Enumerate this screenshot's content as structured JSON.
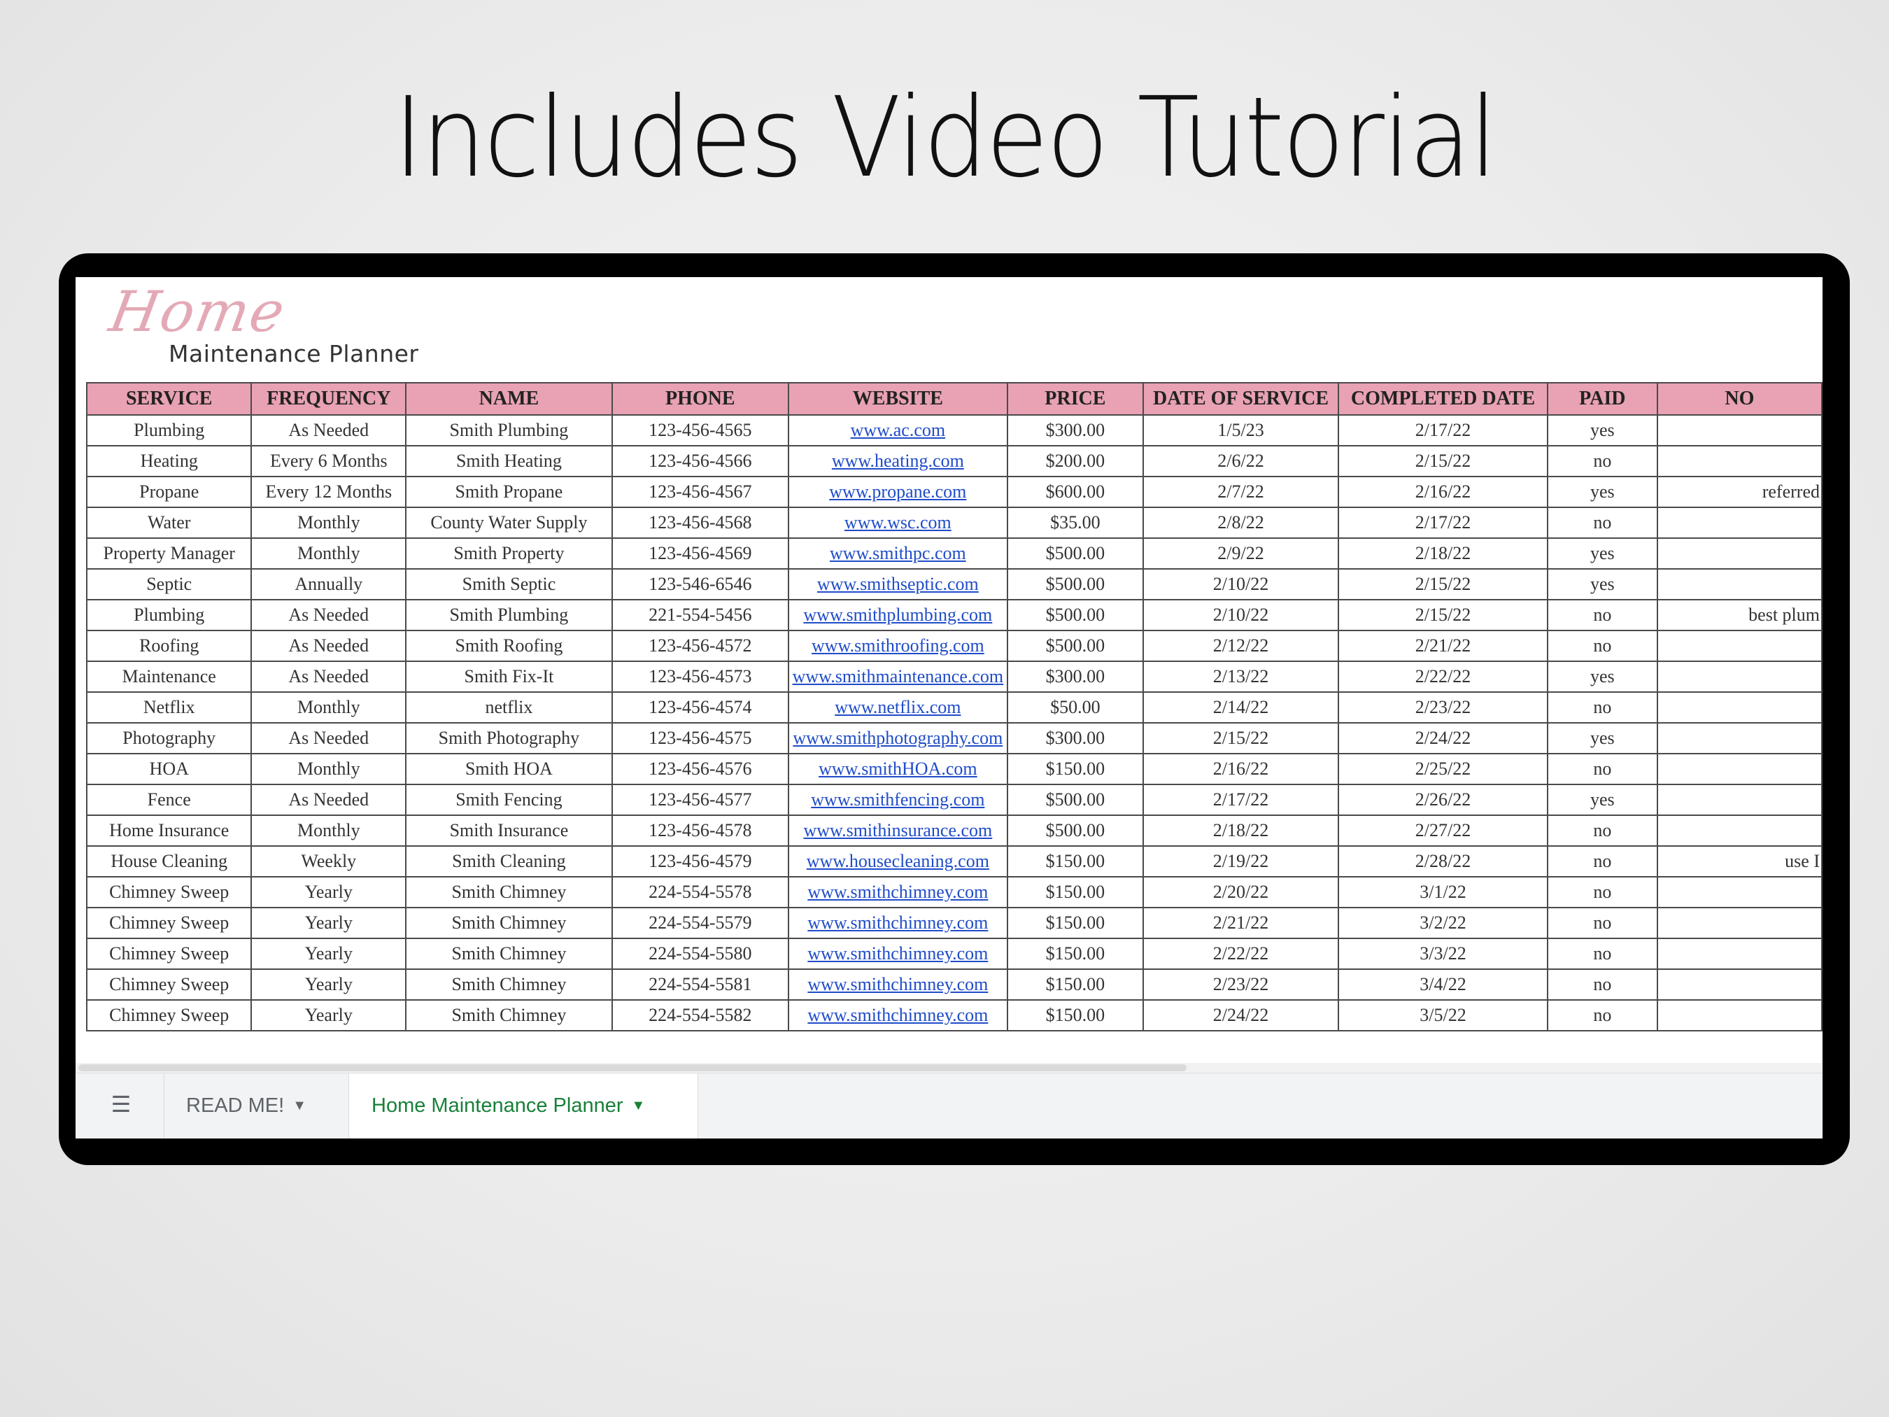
{
  "headline": "Includes Video Tutorial",
  "logo": {
    "script": "Home",
    "subtitle": "Maintenance Planner"
  },
  "table": {
    "columns": [
      "SERVICE",
      "FREQUENCY",
      "NAME",
      "PHONE",
      "WEBSITE",
      "PRICE",
      "DATE OF SERVICE",
      "COMPLETED DATE",
      "PAID",
      "NO"
    ],
    "rows": [
      [
        "Plumbing",
        "As Needed",
        "Smith Plumbing",
        "123-456-4565",
        "www.ac.com",
        "$300.00",
        "1/5/23",
        "2/17/22",
        "yes",
        ""
      ],
      [
        "Heating",
        "Every 6 Months",
        "Smith Heating",
        "123-456-4566",
        "www.heating.com",
        "$200.00",
        "2/6/22",
        "2/15/22",
        "no",
        ""
      ],
      [
        "Propane",
        "Every 12 Months",
        "Smith Propane",
        "123-456-4567",
        "www.propane.com",
        "$600.00",
        "2/7/22",
        "2/16/22",
        "yes",
        "referred"
      ],
      [
        "Water",
        "Monthly",
        "County Water Supply",
        "123-456-4568",
        "www.wsc.com",
        "$35.00",
        "2/8/22",
        "2/17/22",
        "no",
        ""
      ],
      [
        "Property Manager",
        "Monthly",
        "Smith Property",
        "123-456-4569",
        "www.smithpc.com",
        "$500.00",
        "2/9/22",
        "2/18/22",
        "yes",
        ""
      ],
      [
        "Septic",
        "Annually",
        "Smith Septic",
        "123-546-6546",
        "www.smithseptic.com",
        "$500.00",
        "2/10/22",
        "2/15/22",
        "yes",
        ""
      ],
      [
        "Plumbing",
        "As Needed",
        "Smith Plumbing",
        "221-554-5456",
        "www.smithplumbing.com",
        "$500.00",
        "2/10/22",
        "2/15/22",
        "no",
        "best plum"
      ],
      [
        "Roofing",
        "As Needed",
        "Smith Roofing",
        "123-456-4572",
        "www.smithroofing.com",
        "$500.00",
        "2/12/22",
        "2/21/22",
        "no",
        ""
      ],
      [
        "Maintenance",
        "As Needed",
        "Smith Fix-It",
        "123-456-4573",
        "www.smithmaintenance.com",
        "$300.00",
        "2/13/22",
        "2/22/22",
        "yes",
        ""
      ],
      [
        "Netflix",
        "Monthly",
        "netflix",
        "123-456-4574",
        "www.netflix.com",
        "$50.00",
        "2/14/22",
        "2/23/22",
        "no",
        ""
      ],
      [
        "Photography",
        "As Needed",
        "Smith Photography",
        "123-456-4575",
        "www.smithphotography.com",
        "$300.00",
        "2/15/22",
        "2/24/22",
        "yes",
        ""
      ],
      [
        "HOA",
        "Monthly",
        "Smith HOA",
        "123-456-4576",
        "www.smithHOA.com",
        "$150.00",
        "2/16/22",
        "2/25/22",
        "no",
        ""
      ],
      [
        "Fence",
        "As Needed",
        "Smith Fencing",
        "123-456-4577",
        "www.smithfencing.com",
        "$500.00",
        "2/17/22",
        "2/26/22",
        "yes",
        ""
      ],
      [
        "Home Insurance",
        "Monthly",
        "Smith Insurance",
        "123-456-4578",
        "www.smithinsurance.com",
        "$500.00",
        "2/18/22",
        "2/27/22",
        "no",
        ""
      ],
      [
        "House Cleaning",
        "Weekly",
        "Smith Cleaning",
        "123-456-4579",
        "www.housecleaning.com",
        "$150.00",
        "2/19/22",
        "2/28/22",
        "no",
        "use I"
      ],
      [
        "Chimney Sweep",
        "Yearly",
        "Smith Chimney",
        "224-554-5578",
        "www.smithchimney.com",
        "$150.00",
        "2/20/22",
        "3/1/22",
        "no",
        ""
      ],
      [
        "Chimney Sweep",
        "Yearly",
        "Smith Chimney",
        "224-554-5579",
        "www.smithchimney.com",
        "$150.00",
        "2/21/22",
        "3/2/22",
        "no",
        ""
      ],
      [
        "Chimney Sweep",
        "Yearly",
        "Smith Chimney",
        "224-554-5580",
        "www.smithchimney.com",
        "$150.00",
        "2/22/22",
        "3/3/22",
        "no",
        ""
      ],
      [
        "Chimney Sweep",
        "Yearly",
        "Smith Chimney",
        "224-554-5581",
        "www.smithchimney.com",
        "$150.00",
        "2/23/22",
        "3/4/22",
        "no",
        ""
      ],
      [
        "Chimney Sweep",
        "Yearly",
        "Smith Chimney",
        "224-554-5582",
        "www.smithchimney.com",
        "$150.00",
        "2/24/22",
        "3/5/22",
        "no",
        ""
      ]
    ]
  },
  "tabs": {
    "all_sheets_icon": "list-icon",
    "readme_label": "READ ME!",
    "active_label": "Home Maintenance Planner",
    "caret_icon": "caret-down-icon"
  },
  "colors": {
    "header_bg": "#e8a2b3",
    "link": "#1f4cc8",
    "active_tab": "#188038",
    "logo_script": "#e4a9b6"
  }
}
